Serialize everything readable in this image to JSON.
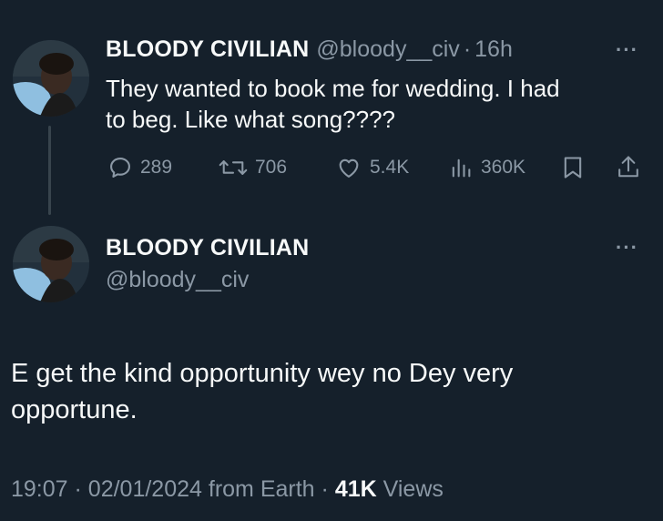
{
  "tweet1": {
    "display_name": "BLOODY CIVILIAN",
    "handle": "@bloody__civ",
    "separator": "·",
    "time": "16h",
    "more_icon": "···",
    "text_line1": "They wanted to book me for wedding. I had",
    "text_line2": "to beg. Like what song????",
    "actions": {
      "replies": "289",
      "retweets": "706",
      "likes": "5.4K",
      "views": "360K"
    }
  },
  "tweet2": {
    "display_name": "BLOODY CIVILIAN",
    "handle": "@bloody__civ",
    "more_icon": "···",
    "text_line1": "E get the kind opportunity wey no Dey very",
    "text_line2": "opportune.",
    "meta": {
      "time": "19:07",
      "separator1": "·",
      "date": "02/01/2024",
      "source": "from Earth",
      "separator2": "·",
      "views_count": "41K",
      "views_label": "Views"
    }
  },
  "colors": {
    "background": "#15202b",
    "primary_text": "#f7f9f9",
    "secondary_text": "#8b98a5",
    "thread_line": "#38444d"
  },
  "icons": [
    "more-icon",
    "reply-icon",
    "retweet-icon",
    "like-icon",
    "views-icon",
    "bookmark-icon",
    "share-icon"
  ]
}
